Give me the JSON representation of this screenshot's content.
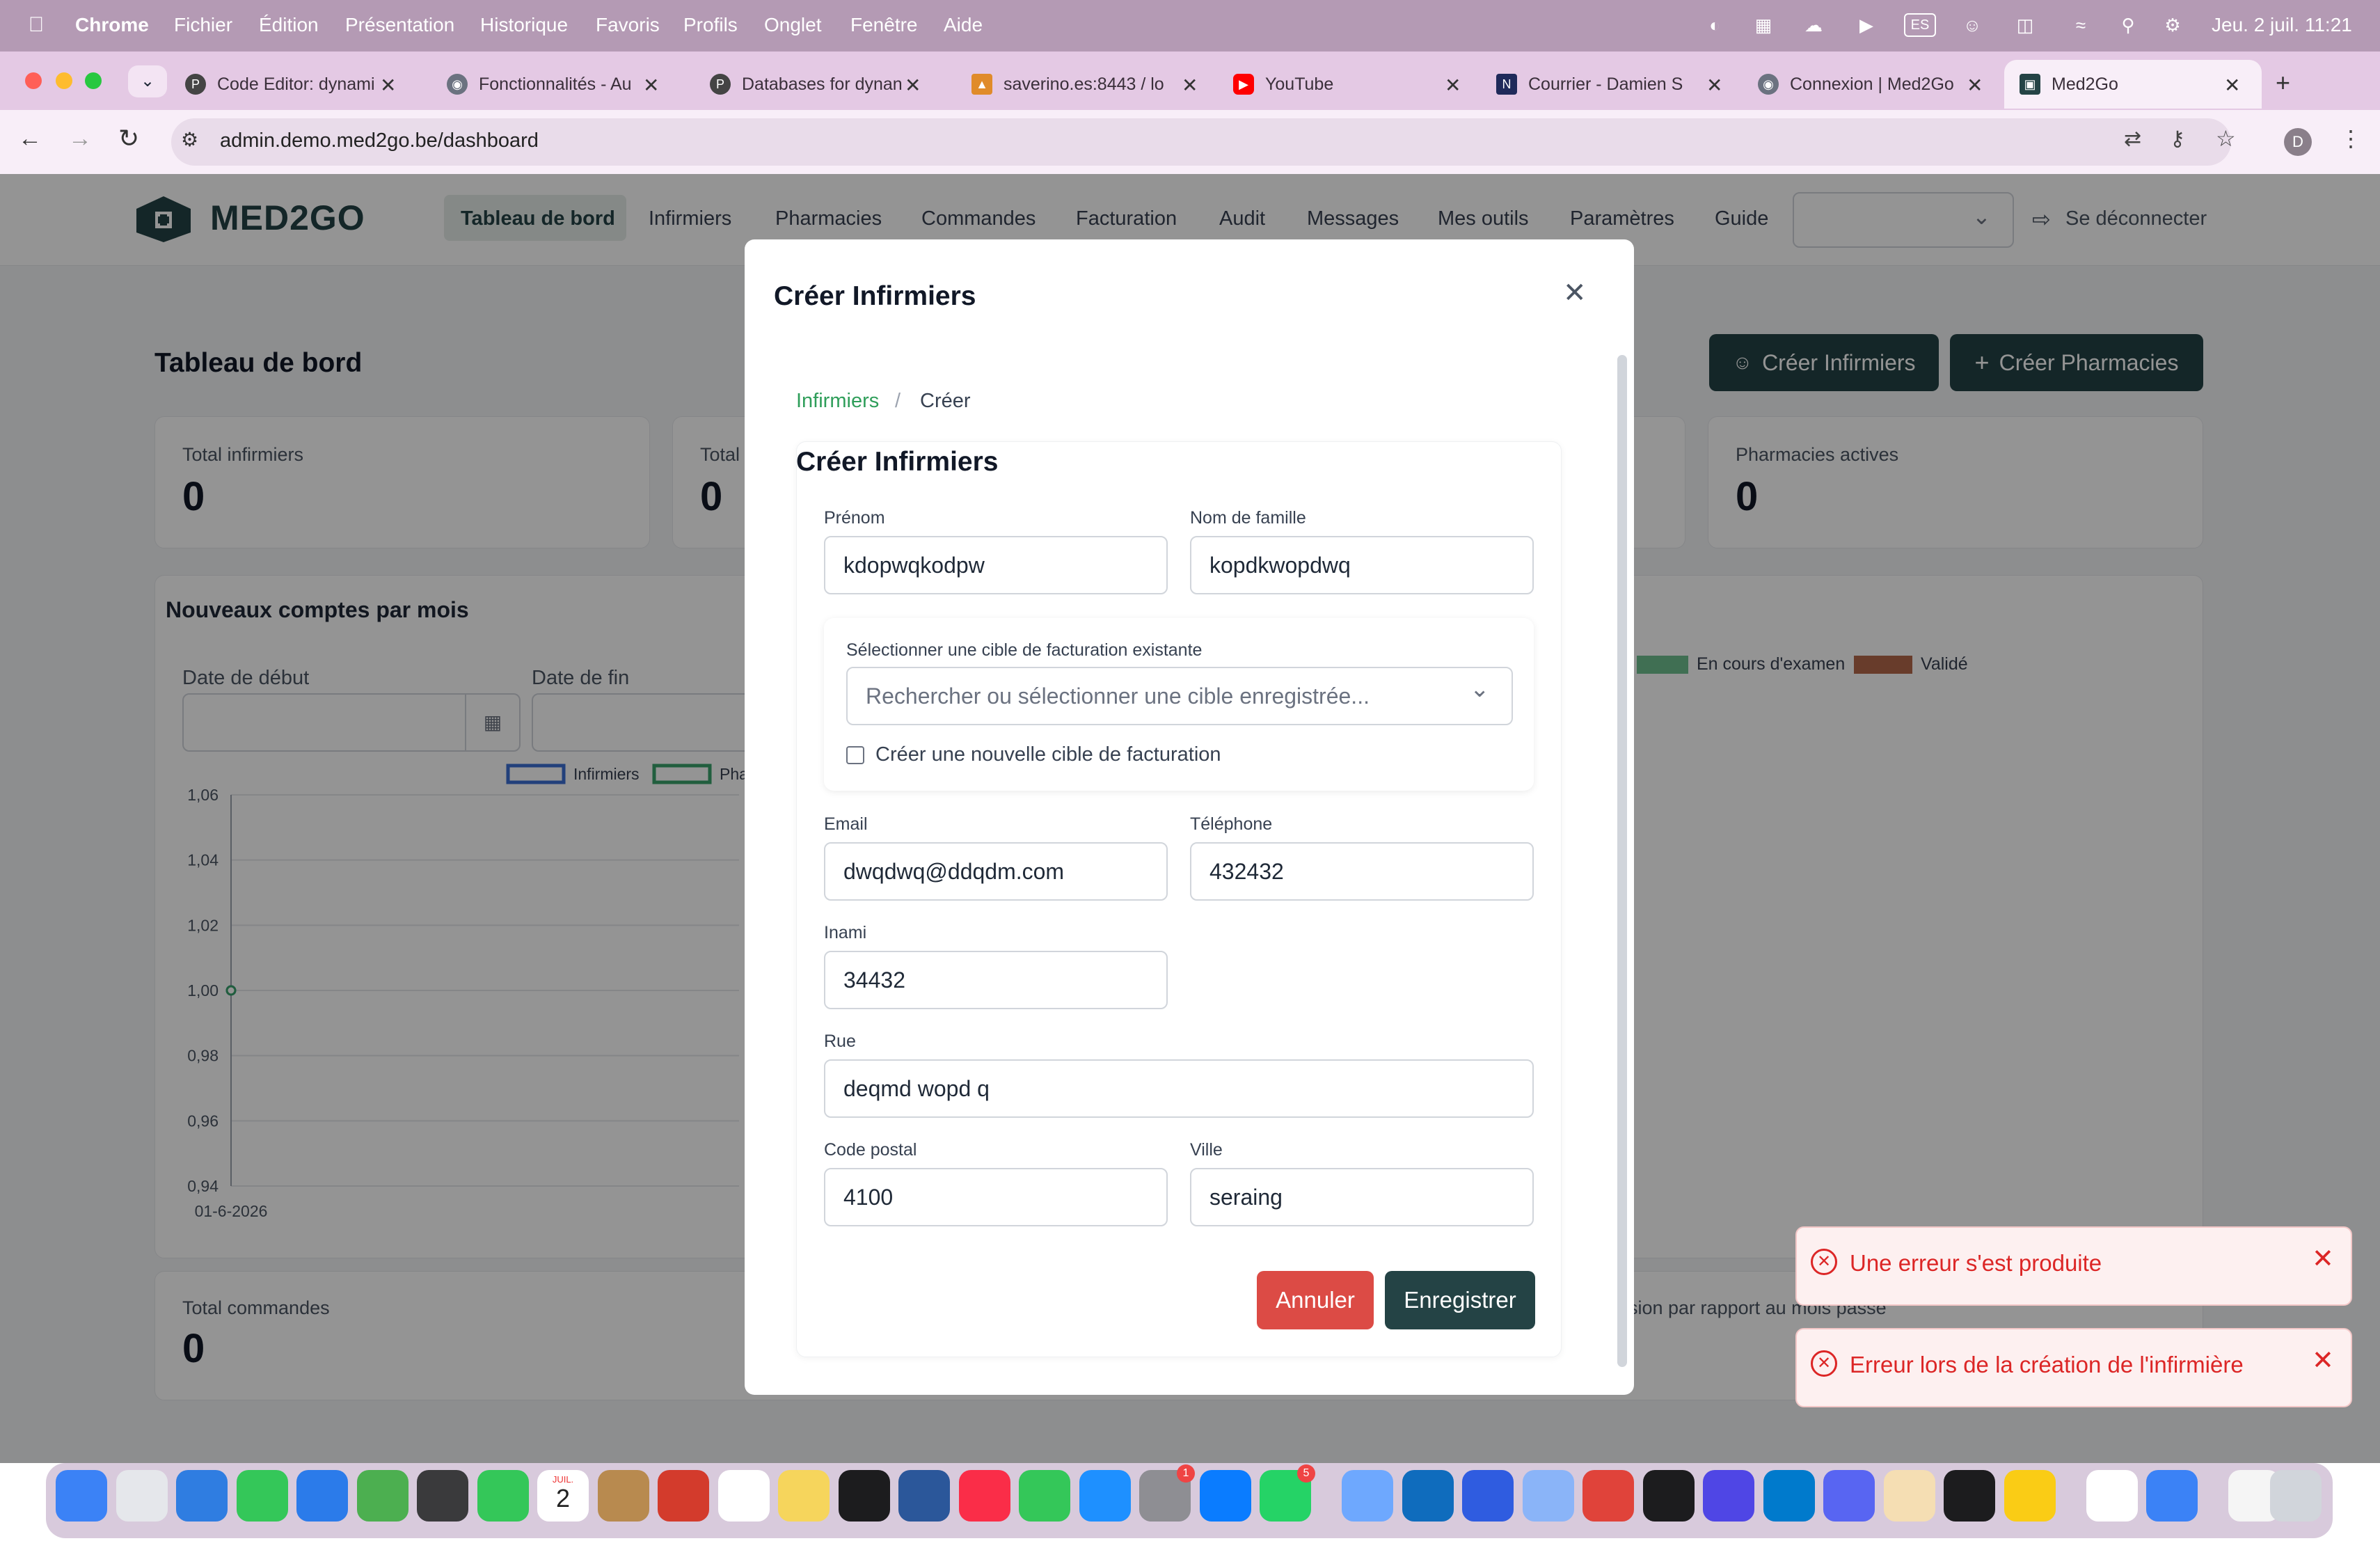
{
  "menubar": {
    "app": "Chrome",
    "items": [
      "Fichier",
      "Édition",
      "Présentation",
      "Historique",
      "Favoris",
      "Profils",
      "Onglet",
      "Fenêtre",
      "Aide"
    ],
    "input_source": "ES",
    "datetime": "Jeu. 2 juil.  11:21"
  },
  "tabs": [
    {
      "title": "Code Editor: dynami",
      "icon": "p-icon"
    },
    {
      "title": "Fonctionnalités - Au",
      "icon": "globe-icon"
    },
    {
      "title": "Databases for dynan",
      "icon": "p-icon"
    },
    {
      "title": "saverino.es:8443 / lo",
      "icon": "pma-icon"
    },
    {
      "title": "YouTube",
      "icon": "youtube-icon"
    },
    {
      "title": "Courrier - Damien S",
      "icon": "mail-icon"
    },
    {
      "title": "Connexion | Med2Go",
      "icon": "globe-icon"
    },
    {
      "title": "Med2Go",
      "icon": "med2go-icon"
    }
  ],
  "browser": {
    "url": "admin.demo.med2go.be/dashboard",
    "profile_initial": "D"
  },
  "app": {
    "logo_text": "MED2GO",
    "nav": [
      "Tableau de bord",
      "Infirmiers",
      "Pharmacies",
      "Commandes",
      "Facturation",
      "Audit",
      "Messages",
      "Mes outils",
      "Paramètres",
      "Guide"
    ],
    "logout": "Se déconnecter",
    "page_title": "Tableau de bord",
    "create_nurse_btn": "Créer Infirmiers",
    "create_pharmacy_btn": "Créer Pharmacies",
    "stats": {
      "total_nurses_label": "Total infirmiers",
      "total_nurses_value": "0",
      "total_partial_label": "Total",
      "total_partial_value": "0",
      "active_pharmacies_label": "Pharmacies actives",
      "active_pharmacies_value": "0",
      "total_orders_label": "Total commandes",
      "total_orders_value": "0",
      "comparison_text": "sion par rapport au mois passé"
    },
    "chart_section": {
      "title": "Nouveaux comptes par mois",
      "start_label": "Date de début",
      "end_label": "Date de fin",
      "legend_right": [
        {
          "name": "En cours d'examen",
          "color": "#6fbf8f"
        },
        {
          "name": "Validé",
          "color": "#b4684a"
        }
      ]
    }
  },
  "chart_data": {
    "type": "line",
    "categories": [
      "01-6-2026"
    ],
    "series": [
      {
        "name": "Infirmiers",
        "color": "#3b6fd4",
        "values": [
          1.0
        ]
      },
      {
        "name": "Pha",
        "color": "#3aa36b",
        "values": [
          1.0
        ]
      }
    ],
    "y_ticks": [
      "1,06",
      "1,04",
      "1,02",
      "1,00",
      "0,98",
      "0,96",
      "0,94"
    ],
    "ylim": [
      0.94,
      1.06
    ],
    "grid": true,
    "legend": "top"
  },
  "modal": {
    "title": "Créer Infirmiers",
    "breadcrumb_link": "Infirmiers",
    "breadcrumb_sep": "/",
    "breadcrumb_current": "Créer",
    "form_title": "Créer Infirmiers",
    "firstname_label": "Prénom",
    "firstname_value": "kdopwqkodpw",
    "lastname_label": "Nom de famille",
    "lastname_value": "kopdkwopdwq",
    "billing_label": "Sélectionner une cible de facturation existante",
    "billing_placeholder": "Rechercher ou sélectionner une cible enregistrée...",
    "new_billing_label": "Créer une nouvelle cible de facturation",
    "email_label": "Email",
    "email_value": "dwqdwq@ddqdm.com",
    "phone_label": "Téléphone",
    "phone_value": "432432",
    "inami_label": "Inami",
    "inami_value": "34432",
    "street_label": "Rue",
    "street_value": "deqmd wopd q",
    "postal_label": "Code postal",
    "postal_value": "4100",
    "city_label": "Ville",
    "city_value": "seraing",
    "cancel_btn": "Annuler",
    "save_btn": "Enregistrer"
  },
  "toasts": [
    {
      "text": "Une erreur s'est produite"
    },
    {
      "text": "Erreur lors de la création de l'infirmière"
    }
  ],
  "colors": {
    "brand_dark": "#244345",
    "danger": "#dc4b45",
    "link_green": "#2f9e5a"
  },
  "dock": {
    "calendar_month": "JUIL.",
    "calendar_day": "2",
    "badges": {
      "settings": "1",
      "whatsapp": "5"
    }
  }
}
